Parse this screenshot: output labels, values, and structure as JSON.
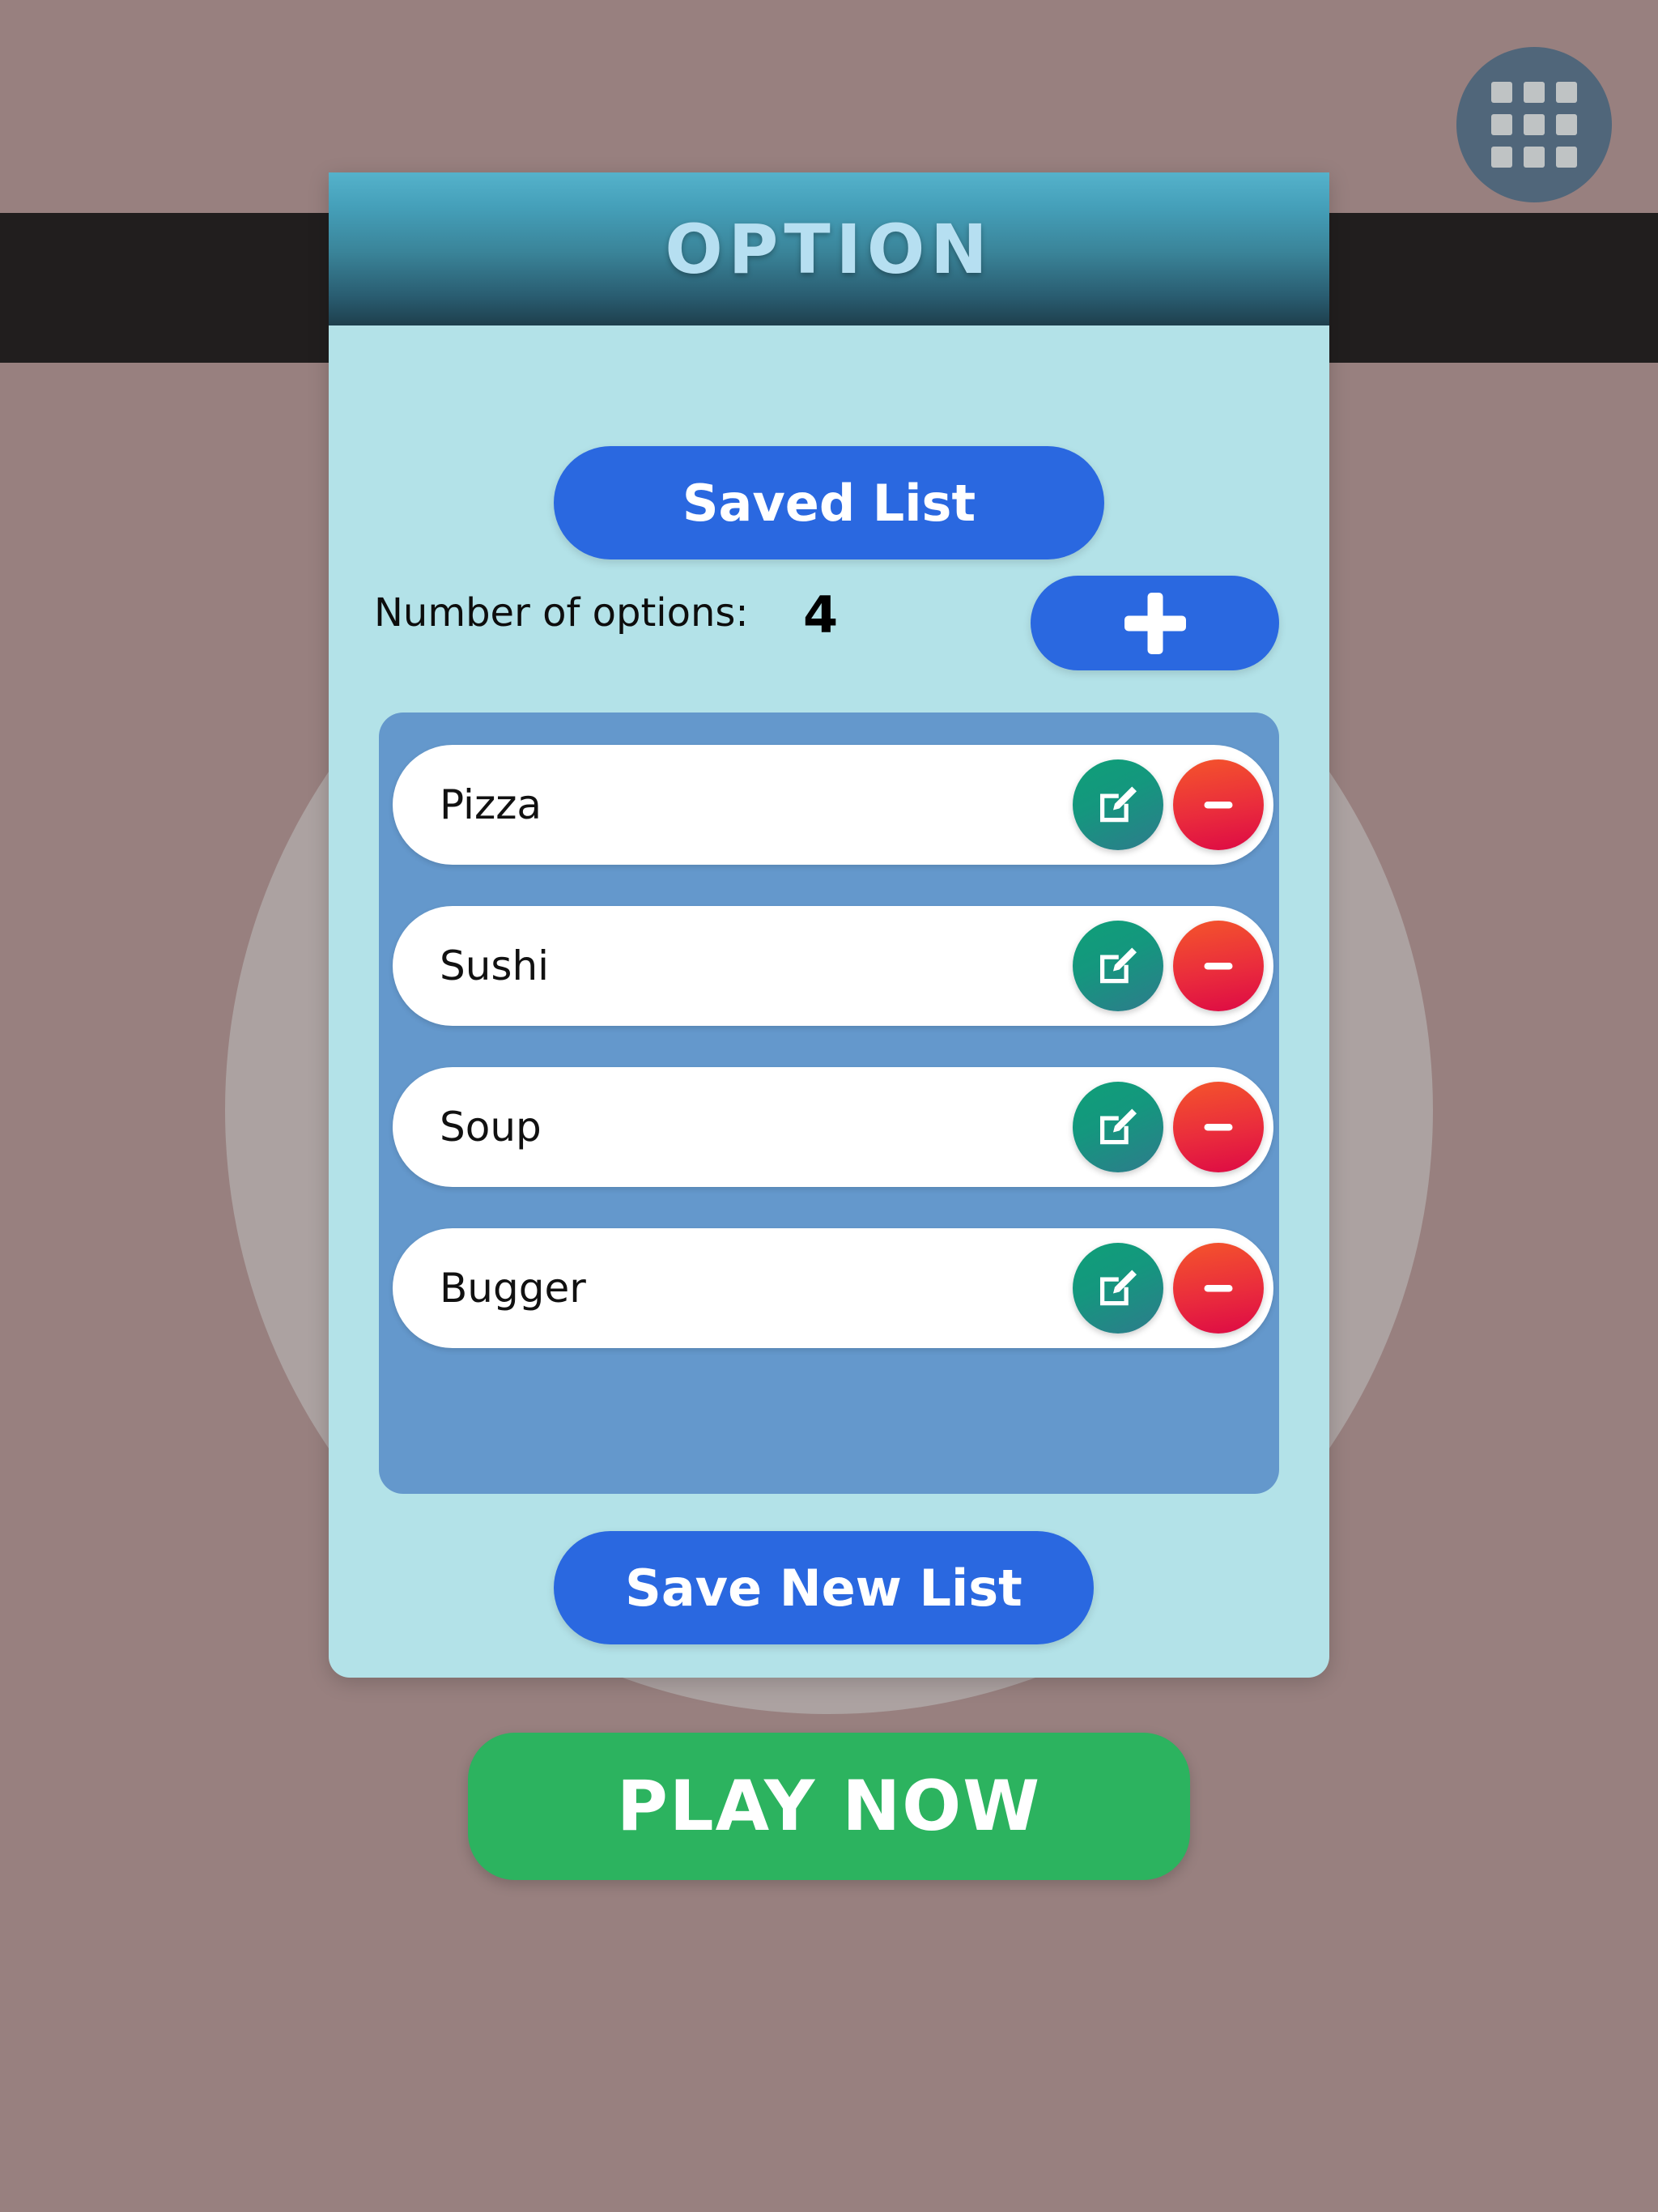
{
  "background": {
    "page_color": "#98807f",
    "band_color": "#211e1e",
    "circle_color": "#bebebe"
  },
  "app_grid_button": {
    "icon": "grid-apps-icon",
    "color": "#3c5f78"
  },
  "dialog": {
    "title": "OPTION",
    "title_color": "#b6dff1",
    "header_gradient_top": "#55b2cb",
    "header_gradient_bottom": "#1e3f4d",
    "body_color": "#b3e2e8"
  },
  "saved_list_button": {
    "label": "Saved List",
    "color": "#2a68e0"
  },
  "counter": {
    "label": "Number of options:",
    "value": "4"
  },
  "add_button": {
    "icon": "plus-icon",
    "color": "#2a68e0"
  },
  "list_panel": {
    "color": "#6498cc",
    "rows": [
      {
        "label": "Pizza",
        "edit_icon": "edit-pencil-icon",
        "delete_icon": "minus-circle-icon"
      },
      {
        "label": "Sushi",
        "edit_icon": "edit-pencil-icon",
        "delete_icon": "minus-circle-icon"
      },
      {
        "label": "Soup",
        "edit_icon": "edit-pencil-icon",
        "delete_icon": "minus-circle-icon"
      },
      {
        "label": "Bugger",
        "edit_icon": "edit-pencil-icon",
        "delete_icon": "minus-circle-icon"
      }
    ],
    "edit_color": "#14977e",
    "delete_color": "#ea2d3c"
  },
  "save_new_list_button": {
    "label": "Save New List",
    "color": "#2a68e0"
  },
  "play_now_button": {
    "label": "PLAY NOW",
    "color": "#2cb35f"
  }
}
